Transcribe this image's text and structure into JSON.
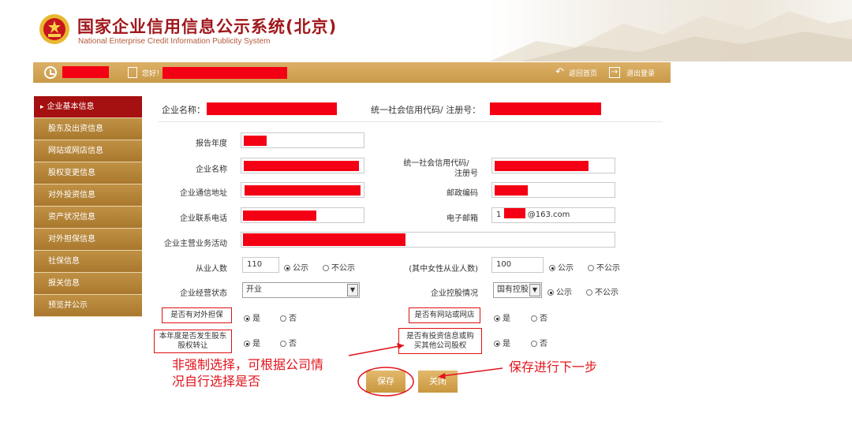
{
  "header": {
    "title": "国家企业信用信息公示系统(北京)",
    "subtitle": "National Enterprise Credit Information Publicity System"
  },
  "topbar": {
    "hello_label": "您好！",
    "back_label": "返回首页",
    "logout_label": "退出登录"
  },
  "sidebar": {
    "items": [
      {
        "label": "企业基本信息",
        "active": true
      },
      {
        "label": "股东及出资信息"
      },
      {
        "label": "网站或网店信息"
      },
      {
        "label": "股权变更信息"
      },
      {
        "label": "对外投资信息"
      },
      {
        "label": "资产状况信息"
      },
      {
        "label": "对外担保信息"
      },
      {
        "label": "社保信息"
      },
      {
        "label": "报关信息"
      },
      {
        "label": "预览并公示"
      }
    ]
  },
  "summary": {
    "company_name_label": "企业名称：",
    "credit_code_label": "统一社会信用代码/ 注册号："
  },
  "form": {
    "report_year_label": "报告年度",
    "company_name_label": "企业名称",
    "credit_code_label_1": "统一社会信用代码/",
    "credit_code_label_2": "注册号",
    "address_label": "企业通信地址",
    "postcode_label": "邮政编码",
    "phone_label": "企业联系电话",
    "email_label": "电子邮箱",
    "email_prefix": "1",
    "email_suffix": "@163.com",
    "main_business_label": "企业主营业务活动",
    "employees_label": "从业人数",
    "employees_value": "110",
    "female_employees_label": "(其中女性从业人数)",
    "female_employees_value": "100",
    "public_label": "公示",
    "not_public_label": "不公示",
    "status_label": "企业经营状态",
    "status_value": "开业",
    "holding_label": "企业控股情况",
    "holding_value": "国有控股",
    "guarantee_label": "是否有对外担保",
    "website_label": "是否有网站或网店",
    "equity_transfer_label_1": "本年度是否发生股东",
    "equity_transfer_label_2": "股权转让",
    "investment_label_1": "是否有投资信息或购",
    "investment_label_2": "买其他公司股权",
    "yes_label": "是",
    "no_label": "否"
  },
  "buttons": {
    "save_label": "保存",
    "close_label": "关闭"
  },
  "annotations": {
    "left_note_1": "非强制选择，可根据公司情",
    "left_note_2": "况自行选择是否",
    "right_note": "保存进行下一步"
  },
  "colors": {
    "brand_red": "#a0171b",
    "gold": "#c99a48",
    "redaction": "#f40014",
    "annotation_red": "#e2141c"
  }
}
